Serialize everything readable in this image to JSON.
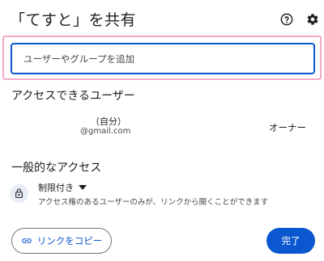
{
  "dialog": {
    "title": "「てすと」を共有",
    "help_icon": "help-circle-icon",
    "settings_icon": "gear-icon"
  },
  "add_people": {
    "placeholder": "ユーザーやグループを追加",
    "value": "",
    "highlight_color": "#f4a9cc",
    "border_color": "#0b57d0"
  },
  "people_with_access": {
    "heading": "アクセスできるユーザー",
    "users": [
      {
        "name": "（自分）",
        "email": "@gmail.com",
        "role": "オーナー"
      }
    ]
  },
  "general_access": {
    "heading": "一般的なアクセス",
    "lock_icon": "lock-icon",
    "selected": "制限付き",
    "dropdown_icon": "caret-down-icon",
    "description": "アクセス権のあるユーザーのみが、リンクから開くことができます"
  },
  "footer": {
    "copy_link_label": "リンクをコピー",
    "link_icon": "link-icon",
    "done_label": "完了",
    "accent_color": "#0b57d0"
  }
}
